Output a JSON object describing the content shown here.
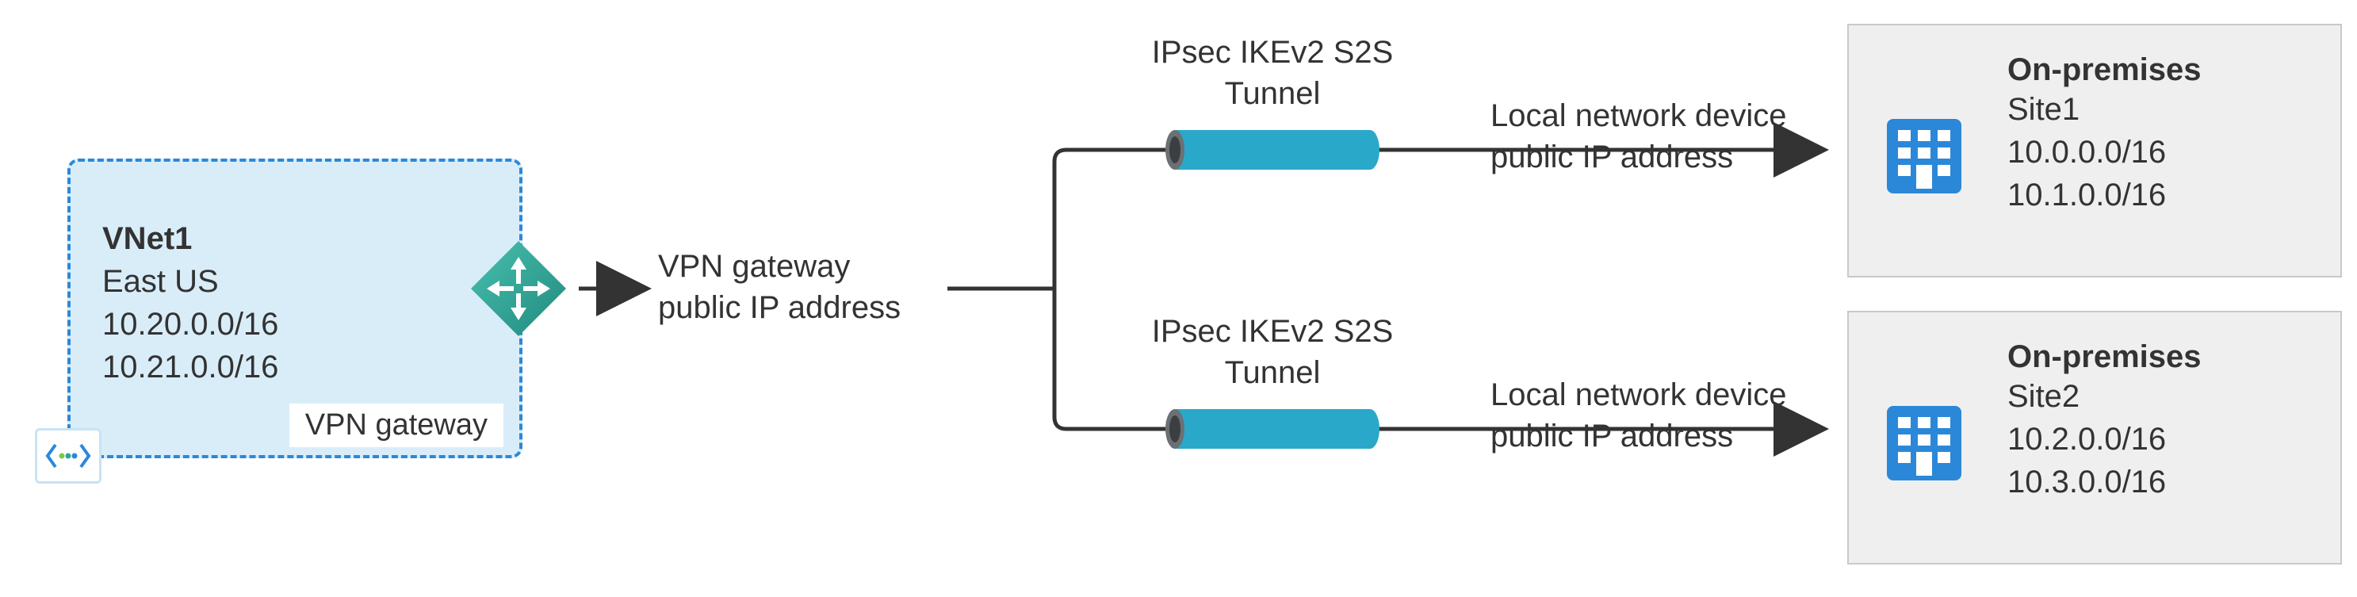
{
  "diagram": {
    "vnet": {
      "title": "VNet1",
      "region": "East US",
      "addressSpaces": [
        "10.20.0.0/16",
        "10.21.0.0/16"
      ],
      "badgeLabel": "VPN gateway"
    },
    "gateway": {
      "label_line1": "VPN gateway",
      "label_line2": "public IP address"
    },
    "tunnels": [
      {
        "label_line1": "IPsec IKEv2 S2S",
        "label_line2": "Tunnel",
        "deviceLabel_line1": "Local network device",
        "deviceLabel_line2": "public IP address"
      },
      {
        "label_line1": "IPsec IKEv2 S2S",
        "label_line2": "Tunnel",
        "deviceLabel_line1": "Local network device",
        "deviceLabel_line2": "public IP address"
      }
    ],
    "sites": [
      {
        "title": "On-premises",
        "name": "Site1",
        "addressSpaces": [
          "10.0.0.0/16",
          "10.1.0.0/16"
        ]
      },
      {
        "title": "On-premises",
        "name": "Site2",
        "addressSpaces": [
          "10.2.0.0/16",
          "10.3.0.0/16"
        ]
      }
    ],
    "colors": {
      "azureBlue": "#2b88d8",
      "lightBlueFill": "#d9edf9",
      "tunnelFill": "#2aa8c9",
      "tealGateway": "#2aa79a",
      "siteBg": "#efefef",
      "siteBorder": "#c9c9c9",
      "connector": "#333333"
    }
  }
}
